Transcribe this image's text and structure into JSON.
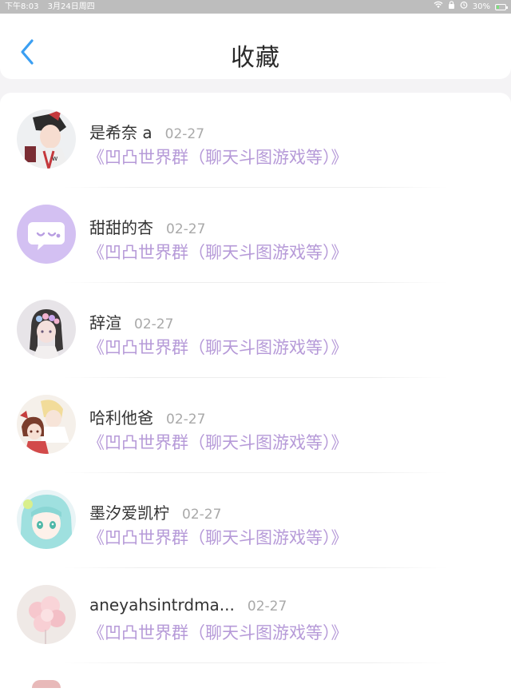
{
  "status_bar": {
    "time": "下午8:03",
    "date": "3月24日周四",
    "battery_text": "30%",
    "battery_level": 0.3,
    "icons": [
      "wifi-icon",
      "lock-icon",
      "alarm-icon",
      "battery-icon"
    ]
  },
  "header": {
    "title": "收藏",
    "back_icon": "chevron-left-icon",
    "accent_color": "#3b9ff2"
  },
  "colors": {
    "group_text": "#b69ad8",
    "date_text": "#a9a9a9",
    "name_text": "#333333"
  },
  "favorites": [
    {
      "name": "是希奈 a",
      "date": "02-27",
      "group": "《凹凸世界群（聊天斗图游戏等）》",
      "avatar": "anime-boy-red-hair-avatar"
    },
    {
      "name": "甜甜的杏",
      "date": "02-27",
      "group": "《凹凸世界群（聊天斗图游戏等）》",
      "avatar": "purple-chat-bubble-avatar"
    },
    {
      "name": "辞渲",
      "date": "02-27",
      "group": "《凹凸世界群（聊天斗图游戏等）》",
      "avatar": "anime-girl-flower-crown-avatar"
    },
    {
      "name": "哈利他爸",
      "date": "02-27",
      "group": "《凹凸世界群（聊天斗图游戏等）》",
      "avatar": "anime-couple-avatar"
    },
    {
      "name": "墨汐爱凯柠",
      "date": "02-27",
      "group": "《凹凸世界群（聊天斗图游戏等）》",
      "avatar": "anime-girl-teal-hair-avatar"
    },
    {
      "name": "aneyahsintrdma...",
      "date": "02-27",
      "group": "《凹凸世界群（聊天斗图游戏等）》",
      "avatar": "pink-balloons-avatar"
    }
  ]
}
